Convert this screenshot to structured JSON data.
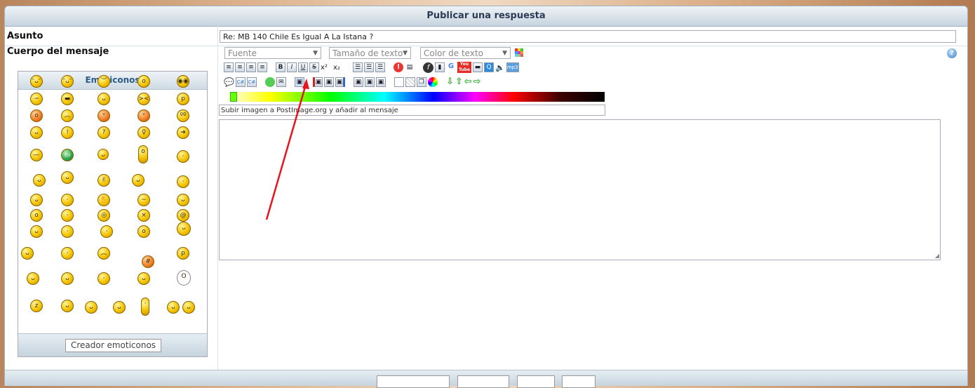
{
  "form": {
    "title": "Publicar una respuesta",
    "subject_label": "Asunto",
    "subject_value": "Re: MB 140 Chile Es Igual A La Istana ?",
    "body_label": "Cuerpo del mensaje"
  },
  "toolbar": {
    "font_select": "Fuente",
    "size_select": "Tamaño de texto",
    "color_select": "Color de texto",
    "bold": "B",
    "italic": "I",
    "underline": "U",
    "strike": "S",
    "superscript": "x²",
    "subscript": "x₂",
    "youtube": "You Tube",
    "upload_text": "Subir imagen a PostImage.org y añadir al mensaje",
    "help": "?"
  },
  "emoticons": {
    "title": "Emoticonos",
    "creator_button": "Creador emoticonos"
  },
  "colors": {
    "arrow": "#e8141c",
    "header_text": "#2b3a55"
  }
}
